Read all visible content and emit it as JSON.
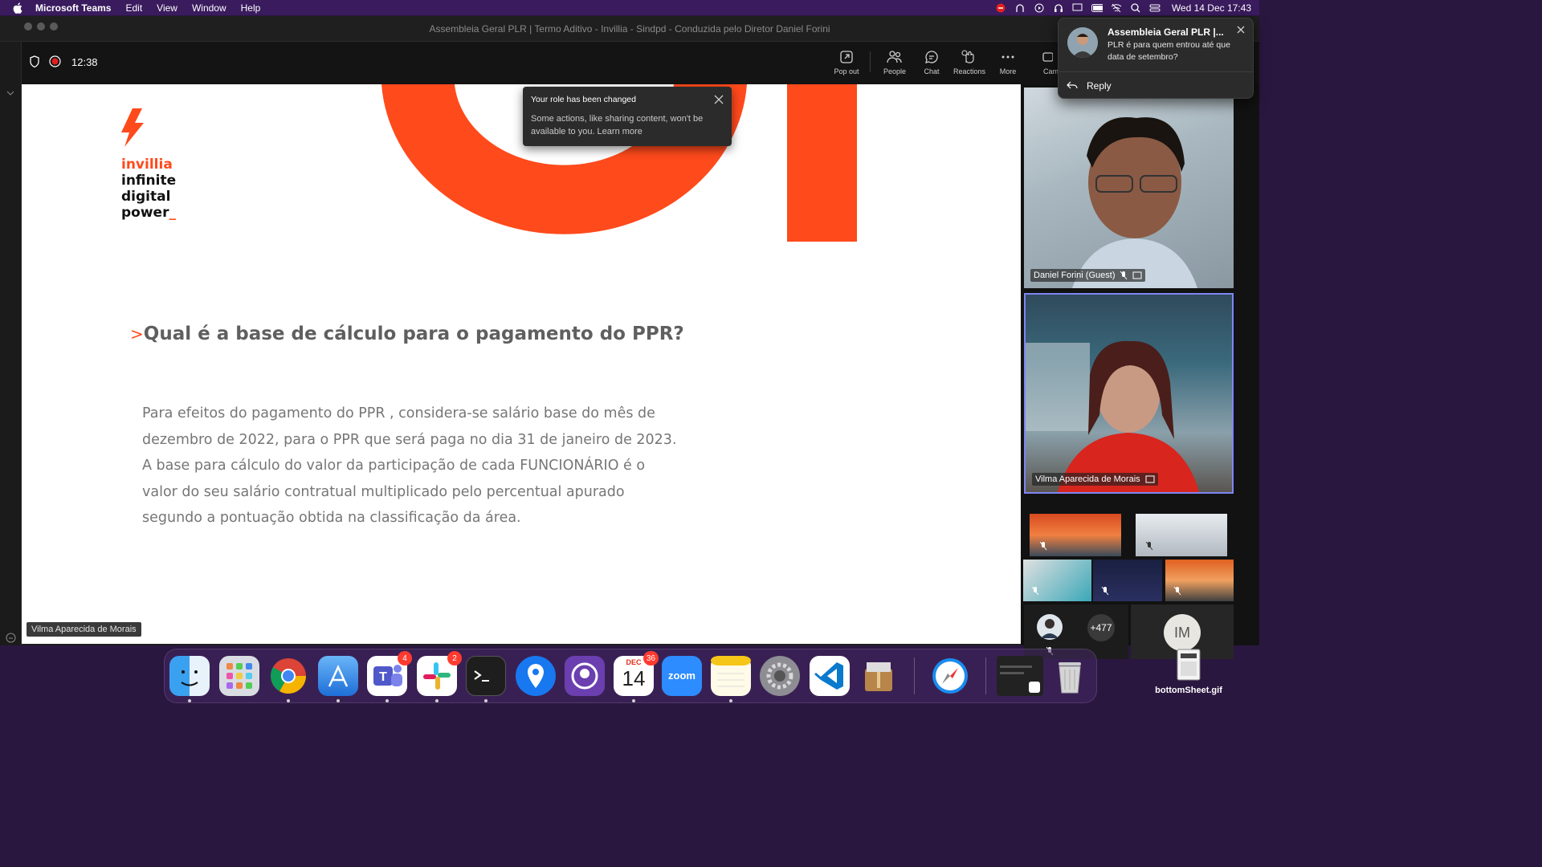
{
  "menubar": {
    "app_name": "Microsoft Teams",
    "items": [
      "Edit",
      "View",
      "Window",
      "Help"
    ],
    "clock": "Wed 14 Dec  17:43"
  },
  "window": {
    "title": "Assembleia Geral PLR | Termo Aditivo - Invillia - Sindpd - Conduzida pelo Diretor Daniel Forini"
  },
  "toolbar": {
    "timer": "12:38",
    "buttons": {
      "popout": "Pop out",
      "people": "People",
      "chat": "Chat",
      "reactions": "Reactions",
      "more": "More",
      "camera": "Cam"
    }
  },
  "slide": {
    "brand": "invillia",
    "tagline_lines": [
      "infinite",
      "digital",
      "power"
    ],
    "tagline_cursor": "_",
    "question_marker": ">",
    "question": "Qual é a base de cálculo para o pagamento do PPR?",
    "body_lines": [
      "Para efeitos do pagamento do PPR , considera-se salário base do mês de",
      "dezembro de 2022, para o PPR que será paga no dia 31 de janeiro de 2023.",
      "A base para cálculo do valor da participação de cada FUNCIONÁRIO é o",
      "valor do seu salário contratual multiplicado pelo percentual apurado",
      "segundo a pontuação obtida na classificação da área."
    ],
    "accent_color": "#ff4a1c"
  },
  "presenter_tag": "Vilma Aparecida de Morais",
  "toast": {
    "title": "Your role has been changed",
    "body": "Some actions, like sharing content, won't be available to you. Learn more"
  },
  "notification": {
    "title": "Assembleia Geral PLR |...",
    "message": "PLR é para quem entrou até que data de setembro?",
    "reply": "Reply"
  },
  "participants": {
    "main": [
      {
        "name": "Daniel Forini (Guest)"
      },
      {
        "name": "Vilma Aparecida de Morais"
      }
    ],
    "overflow_count": "+477",
    "initials": "IM"
  },
  "dock": {
    "apps": [
      "Finder",
      "Launchpad",
      "Chrome",
      "Xcode",
      "Teams",
      "Slack",
      "Terminal",
      "Maps",
      "GitHub Desktop",
      "Calendar",
      "Zoom",
      "Notes",
      "System Settings",
      "VS Code",
      "Archive Utility",
      "Safari",
      "Screen",
      "Trash"
    ],
    "badges": {
      "teams": "4",
      "slack": "2",
      "calendar": "36"
    },
    "calendar_month": "DEC",
    "calendar_day": "14",
    "zoom_label": "zoom"
  },
  "desktop_file": "bottomSheet.gif"
}
